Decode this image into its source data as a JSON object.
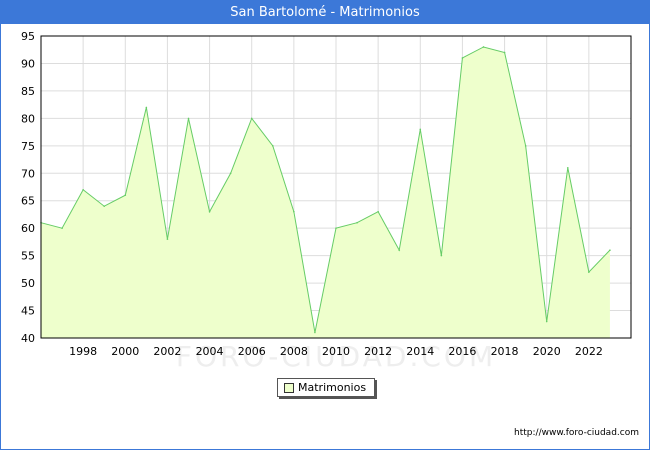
{
  "title": "San Bartolomé - Matrimonios",
  "footer_url": "http://www.foro-ciudad.com",
  "watermark": "FORO-CIUDAD.COM",
  "colors": {
    "header": "#3c78d8",
    "fill": "#eeffcc",
    "line": "#66cc66",
    "grid": "#dddddd"
  },
  "chart_data": {
    "type": "area",
    "title": "San Bartolomé - Matrimonios",
    "xlabel": "",
    "ylabel": "",
    "x": [
      1996,
      1997,
      1998,
      1999,
      2000,
      2001,
      2002,
      2003,
      2004,
      2005,
      2006,
      2007,
      2008,
      2009,
      2010,
      2011,
      2012,
      2013,
      2014,
      2015,
      2016,
      2017,
      2018,
      2019,
      2020,
      2021,
      2022,
      2023
    ],
    "series": [
      {
        "name": "Matrimonios",
        "values": [
          61,
          60,
          67,
          64,
          66,
          82,
          58,
          80,
          63,
          70,
          80,
          75,
          63,
          41,
          60,
          61,
          63,
          56,
          78,
          55,
          91,
          93,
          92,
          75,
          43,
          71,
          52,
          56
        ]
      }
    ],
    "x_ticks": [
      "1998",
      "2000",
      "2002",
      "2004",
      "2006",
      "2008",
      "2010",
      "2012",
      "2014",
      "2016",
      "2018",
      "2020",
      "2022"
    ],
    "y_ticks": [
      "40",
      "45",
      "50",
      "55",
      "60",
      "65",
      "70",
      "75",
      "80",
      "85",
      "90",
      "95"
    ],
    "xlim": [
      1996,
      2024
    ],
    "ylim": [
      40,
      95
    ],
    "grid": true,
    "legend": "bottom-center"
  }
}
